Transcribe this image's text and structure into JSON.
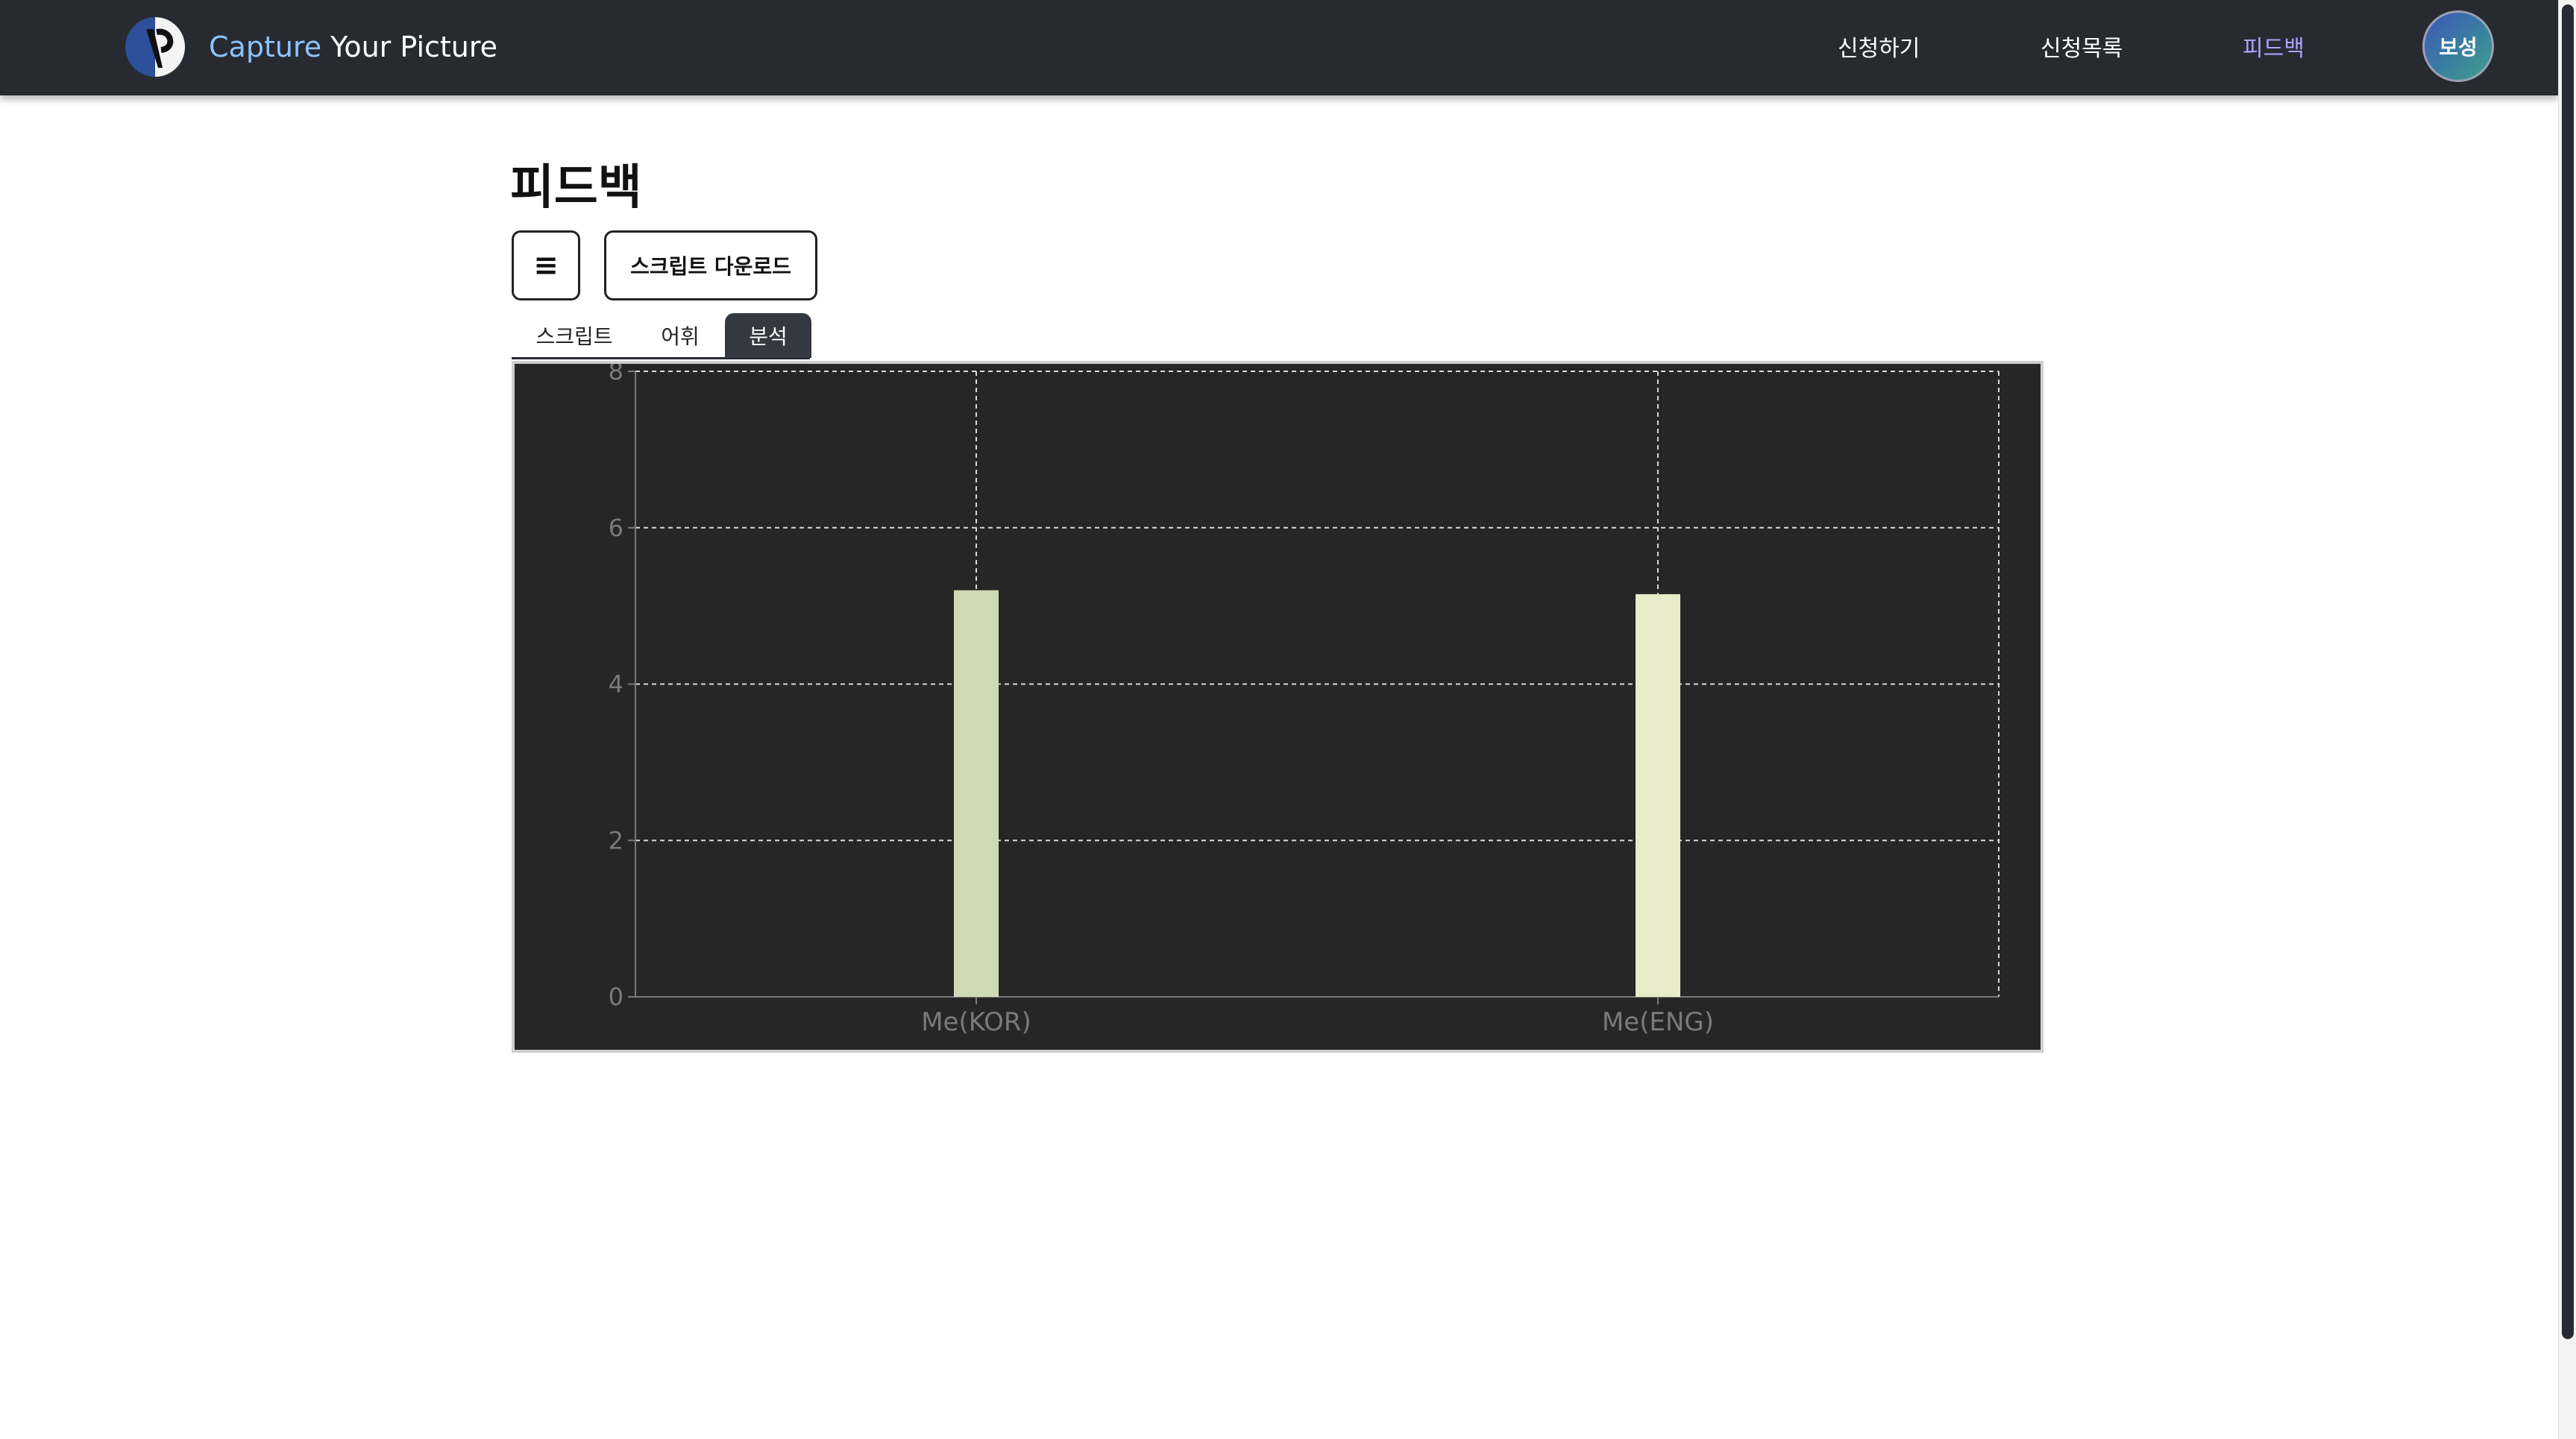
{
  "header": {
    "brand": {
      "accent": "Capture",
      "rest": " Your Picture"
    },
    "nav": [
      {
        "label": "신청하기",
        "active": false
      },
      {
        "label": "신청목록",
        "active": false
      },
      {
        "label": "피드백",
        "active": true
      }
    ],
    "avatar_label": "보성"
  },
  "page": {
    "title": "피드백",
    "menu_button_label": "≡",
    "download_button_label": "스크립트 다운로드",
    "tabs": [
      {
        "label": "스크립트",
        "active": false
      },
      {
        "label": "어휘",
        "active": false
      },
      {
        "label": "분석",
        "active": true
      }
    ]
  },
  "colors": {
    "navbar_bg": "#272a30",
    "active_nav": "#a9a4ff",
    "chart_bg": "#262626",
    "bar_kor": "#cfd9b4",
    "bar_eng": "#e8ecc8"
  },
  "chart_data": {
    "type": "bar",
    "categories": [
      "Me(KOR)",
      "Me(ENG)"
    ],
    "values": [
      5.2,
      5.15
    ],
    "bar_colors": [
      "#cfd9b4",
      "#e8ecc8"
    ],
    "ylim": [
      0,
      8
    ],
    "yticks": [
      "0",
      "2",
      "4",
      "6",
      "8"
    ],
    "grid": true,
    "title": "",
    "xlabel": "",
    "ylabel": ""
  }
}
